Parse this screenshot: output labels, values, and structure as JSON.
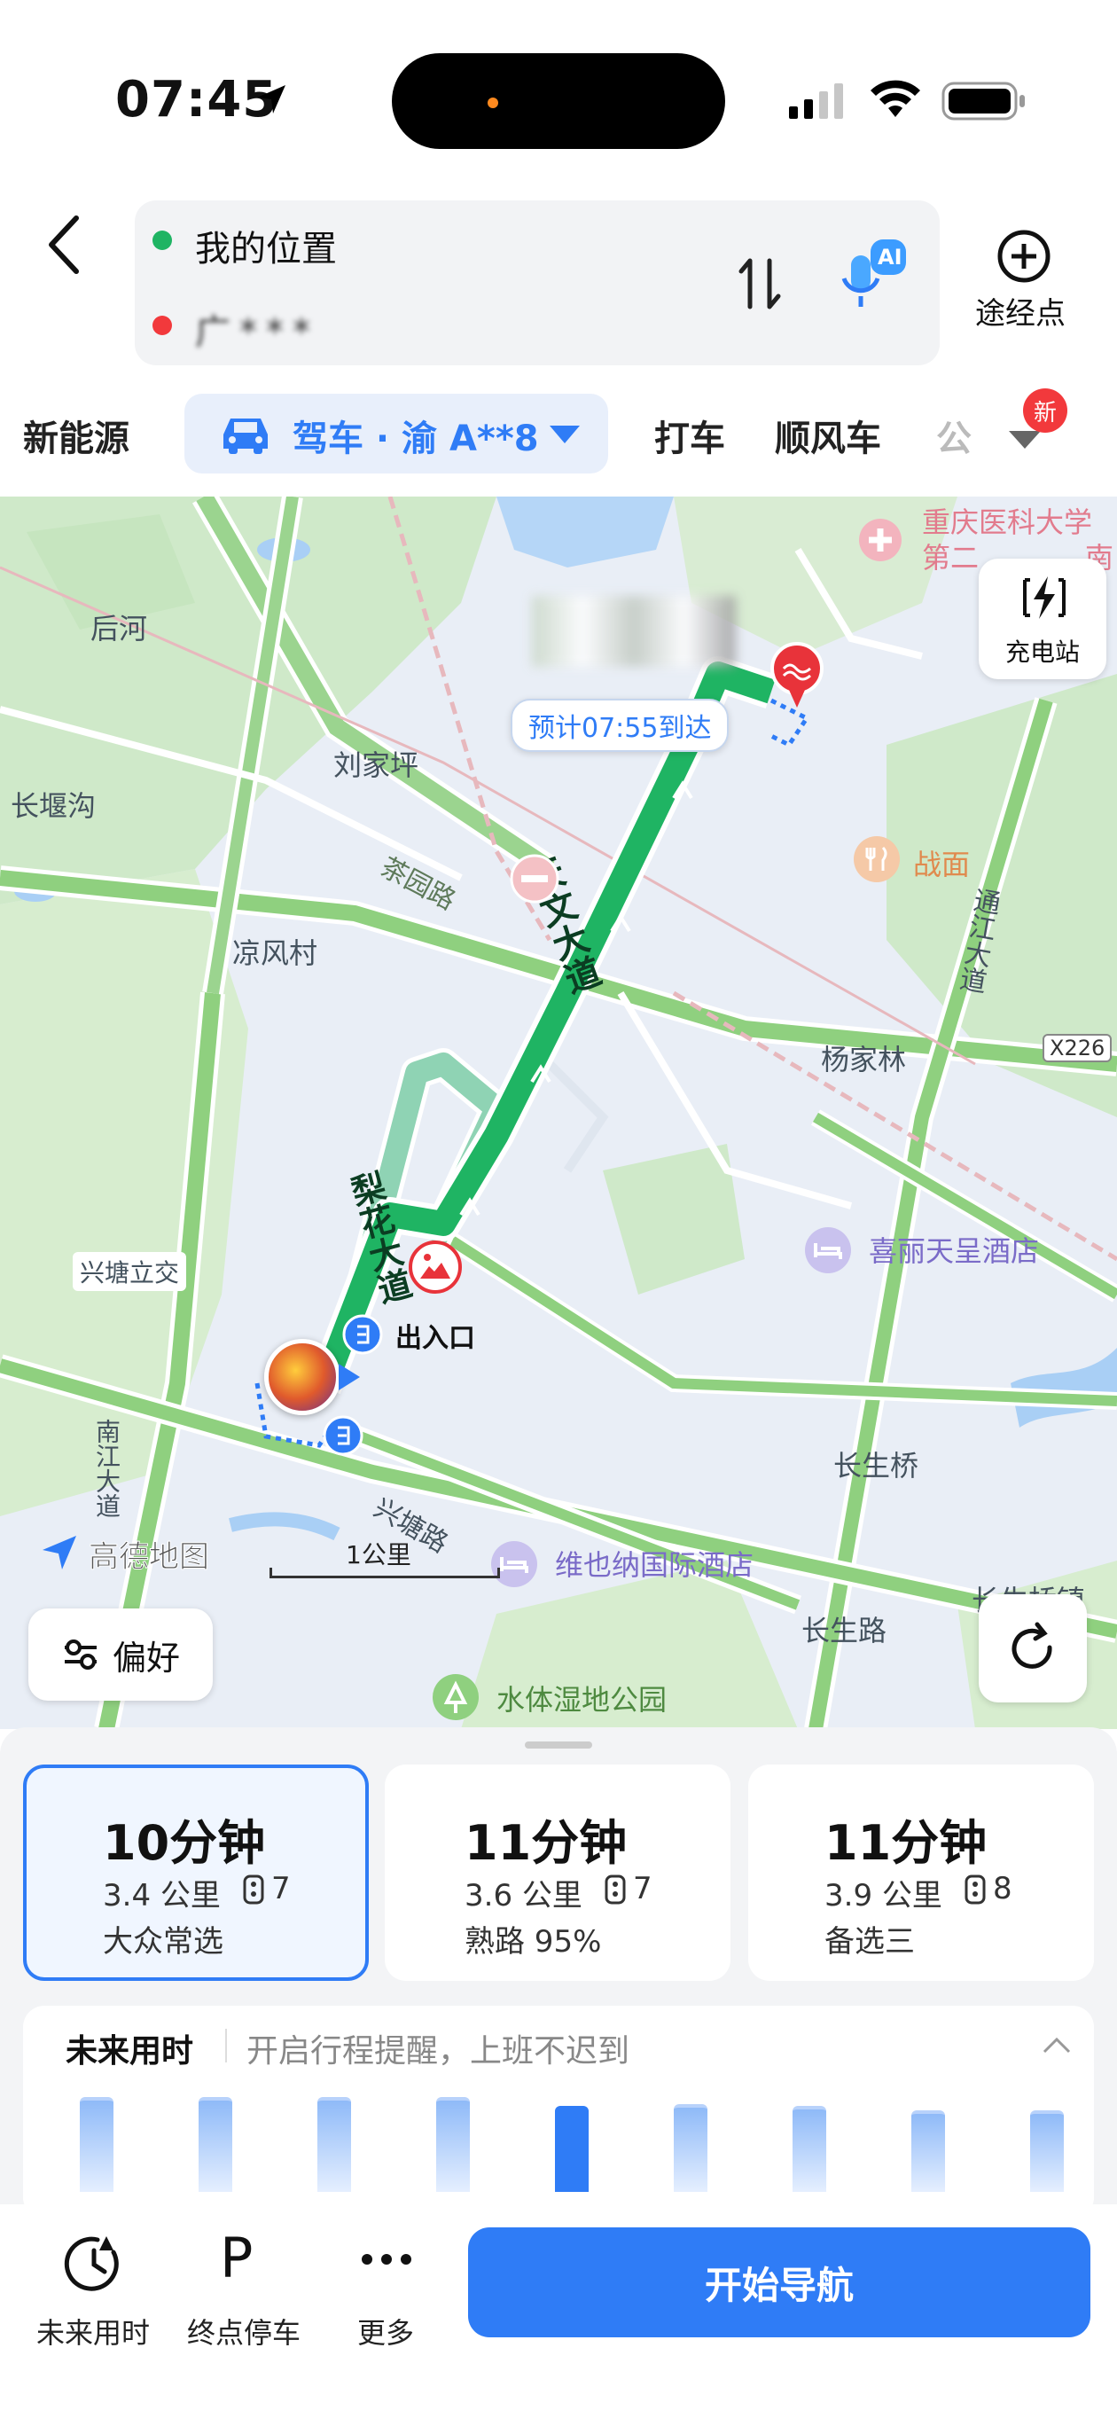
{
  "status_bar": {
    "time": "07:45",
    "battery": "full",
    "icons": [
      "location-arrow-icon",
      "signal-icon",
      "wifi-icon",
      "battery-icon"
    ]
  },
  "route": {
    "origin": "我的位置",
    "destination": "广***",
    "swap_icon": "swap-vertical-icon",
    "ai_label": "AI",
    "waypoint_label": "途经点"
  },
  "modes": {
    "new_energy": "新能源",
    "drive": "驾车 · 渝 A**8",
    "taxi": "打车",
    "carpool": "顺风车",
    "bus_partial": "公",
    "new_badge": "新"
  },
  "map": {
    "charging_label": "充电站",
    "eta_label": "预计07:55到达",
    "entrance_label": "出入口",
    "provider_label": "高德地图",
    "scale_label": "1公里",
    "preference_label": "偏好",
    "places": {
      "houhe": "后河",
      "changyangou": "长堰沟",
      "liujiaping": "刘家坪",
      "chayuan_road": "茶园路",
      "liangfengcun": "凉风村",
      "xingtangli": "兴塘立交",
      "nanjiang": "南江大道",
      "tianwen": "天文大道",
      "lihua": "梨花大道",
      "xingtang_road": "兴塘路",
      "zhanmian": "战面",
      "tongjiang": "通江大道",
      "yangjialin": "杨家林",
      "x226": "X226",
      "xili_hotel": "喜丽天呈酒店",
      "changshengqiao": "长生桥",
      "vienna_hotel": "维也纳国际酒店",
      "changsheng_road": "长生路",
      "wetland_park": "水体湿地公园",
      "cq_hospital": "重庆医科大学",
      "hospital_line2": "第二",
      "hospital_line2b": "南",
      "changshengqiao_town": "长生桥镇"
    }
  },
  "routes": [
    {
      "time": "10分钟",
      "distance": "3.4 公里",
      "lights": "7",
      "tag": "大众常选",
      "selected": true
    },
    {
      "time": "11分钟",
      "distance": "3.6 公里",
      "lights": "7",
      "tag": "熟路 95%",
      "selected": false
    },
    {
      "time": "11分钟",
      "distance": "3.9 公里",
      "lights": "8",
      "tag": "备选三",
      "selected": false
    }
  ],
  "future": {
    "title": "未来用时",
    "hint": "开启行程提醒，上班不迟到",
    "bars": [
      0.86,
      0.86,
      0.86,
      0.86,
      0.78,
      0.8,
      0.78,
      0.74,
      0.74
    ],
    "highlight_index": 4
  },
  "bottom": {
    "future_time": "未来用时",
    "parking": "终点停车",
    "more": "更多",
    "start_nav": "开始导航"
  },
  "colors": {
    "accent": "#2f7cf6",
    "route_green": "#1fb463",
    "alt_route": "#8fd3b4"
  }
}
